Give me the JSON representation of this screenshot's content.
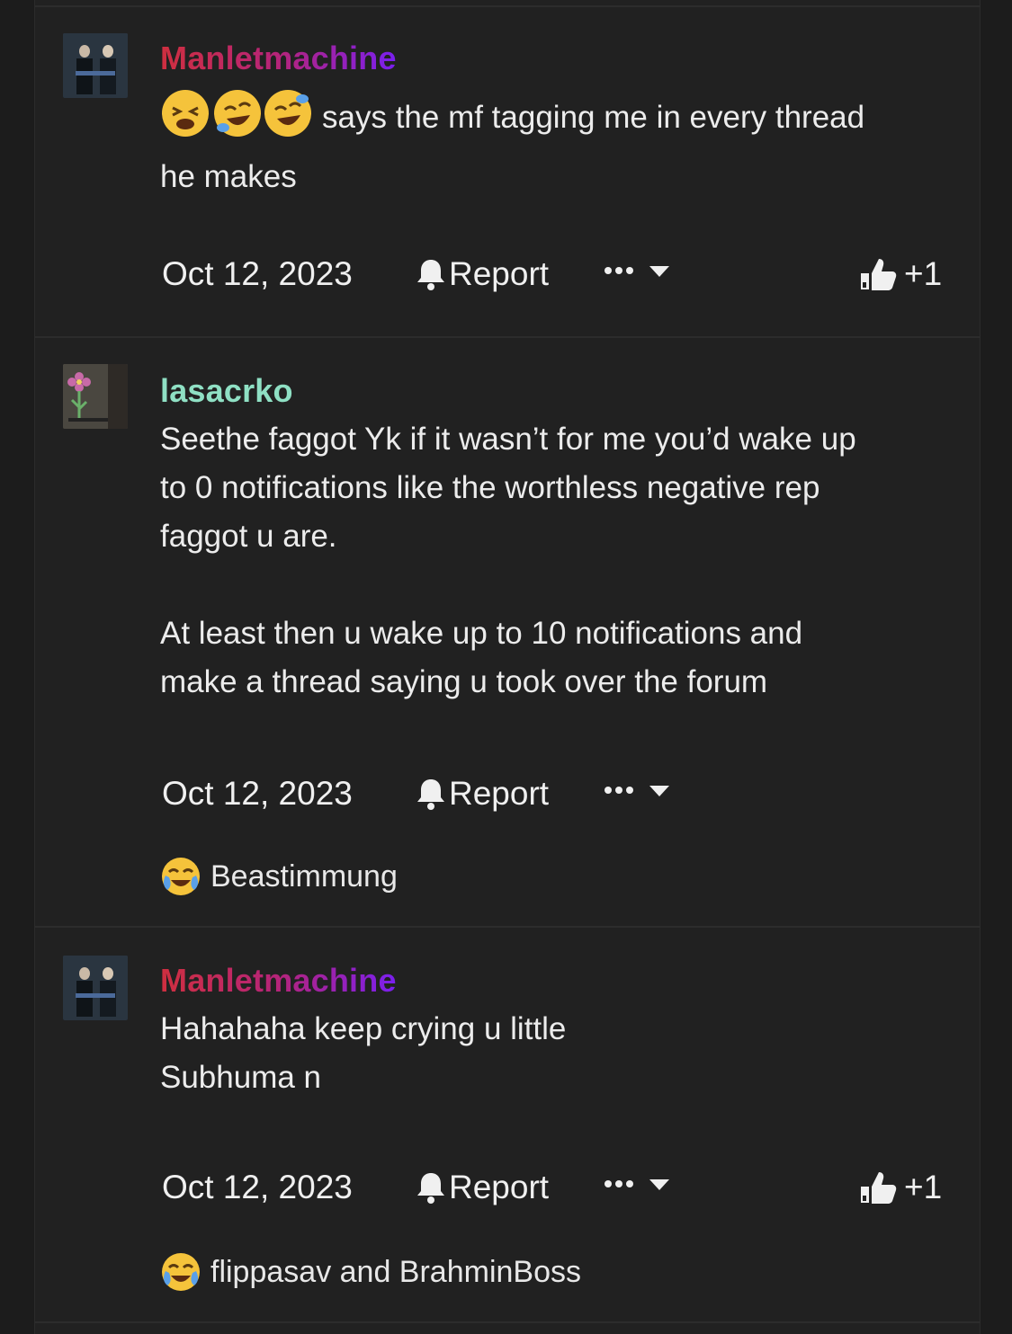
{
  "posts": [
    {
      "username": "Manletmachine",
      "avatar": "miami-vice-avatar",
      "body_lines": [
        "says the mf tagging me in every thread",
        "he makes"
      ],
      "date": "Oct 12, 2023",
      "report_label": "Report",
      "like_count": "+1"
    },
    {
      "username": "lasacrko",
      "avatar": "flower-drawing-avatar",
      "paragraphs": [
        [
          "Seethe faggot Yk if it wasn’t for me you’d wake up",
          "to 0 notifications like the worthless negative rep",
          "faggot u are."
        ],
        [
          "At least then u wake up to 10 notifications and",
          "make a thread saying u took over the forum"
        ]
      ],
      "date": "Oct 12, 2023",
      "report_label": "Report",
      "reactions": "Beastimmung"
    },
    {
      "username": "Manletmachine",
      "avatar": "miami-vice-avatar",
      "body_lines": [
        "Hahahaha keep crying u little",
        "Subhuma n"
      ],
      "date": "Oct 12, 2023",
      "report_label": "Report",
      "like_count": "+1",
      "reactions": "flippasav and BrahminBoss"
    }
  ],
  "colors": {
    "background": "#1c1c1c",
    "post_background": "#212121",
    "username_gradient": [
      "#cf2f3f",
      "#7a1ff0"
    ],
    "username_mint": "#8fe0c4"
  }
}
